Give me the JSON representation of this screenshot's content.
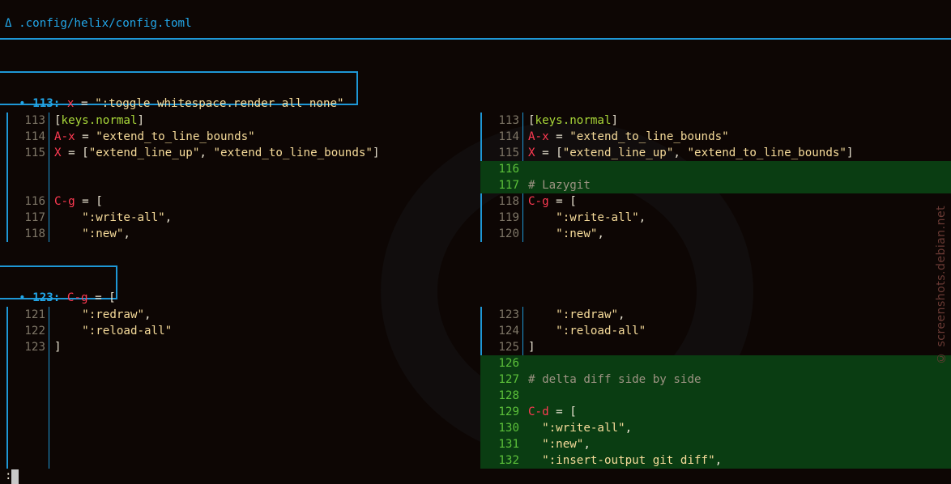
{
  "file_header": {
    "icon": "Δ",
    "path": ".config/helix/config.toml"
  },
  "hunks": [
    {
      "header": {
        "bullet": "•",
        "line_no": "113:",
        "code": [
          {
            "t": "x",
            "c": "k"
          },
          {
            "t": " = ",
            "c": "p"
          },
          {
            "t": "\":toggle whitespace.render all none\"",
            "c": "s"
          }
        ]
      },
      "left": [
        {
          "num": "113",
          "code": [
            {
              "t": "[",
              "c": "p"
            },
            {
              "t": "keys.normal",
              "c": "t"
            },
            {
              "t": "]",
              "c": "p"
            }
          ]
        },
        {
          "num": "114",
          "code": [
            {
              "t": "A-x",
              "c": "k"
            },
            {
              "t": " = ",
              "c": "p"
            },
            {
              "t": "\"extend_to_line_bounds\"",
              "c": "s"
            }
          ]
        },
        {
          "num": "115",
          "code": [
            {
              "t": "X",
              "c": "k"
            },
            {
              "t": " = [",
              "c": "p"
            },
            {
              "t": "\"extend_line_up\"",
              "c": "s"
            },
            {
              "t": ", ",
              "c": "p"
            },
            {
              "t": "\"extend_to_line_bounds\"",
              "c": "s"
            },
            {
              "t": "]",
              "c": "p"
            }
          ]
        },
        {
          "num": "",
          "code": []
        },
        {
          "num": "",
          "code": []
        },
        {
          "num": "116",
          "code": [
            {
              "t": "C-g",
              "c": "k"
            },
            {
              "t": " = [",
              "c": "p"
            }
          ]
        },
        {
          "num": "117",
          "code": [
            {
              "t": "    ",
              "c": "p"
            },
            {
              "t": "\":write-all\"",
              "c": "s"
            },
            {
              "t": ",",
              "c": "p"
            }
          ]
        },
        {
          "num": "118",
          "code": [
            {
              "t": "    ",
              "c": "p"
            },
            {
              "t": "\":new\"",
              "c": "s"
            },
            {
              "t": ",",
              "c": "p"
            }
          ]
        }
      ],
      "right": [
        {
          "num": "113",
          "code": [
            {
              "t": "[",
              "c": "p"
            },
            {
              "t": "keys.normal",
              "c": "t"
            },
            {
              "t": "]",
              "c": "p"
            }
          ]
        },
        {
          "num": "114",
          "code": [
            {
              "t": "A-x",
              "c": "k"
            },
            {
              "t": " = ",
              "c": "p"
            },
            {
              "t": "\"extend_to_line_bounds\"",
              "c": "s"
            }
          ]
        },
        {
          "num": "115",
          "code": [
            {
              "t": "X",
              "c": "k"
            },
            {
              "t": " = [",
              "c": "p"
            },
            {
              "t": "\"extend_line_up\"",
              "c": "s"
            },
            {
              "t": ", ",
              "c": "p"
            },
            {
              "t": "\"extend_to_line_bounds\"",
              "c": "s"
            },
            {
              "t": "]",
              "c": "p"
            }
          ]
        },
        {
          "num": "116",
          "added": true,
          "code": []
        },
        {
          "num": "117",
          "added": true,
          "code": [
            {
              "t": "# Lazygit",
              "c": "c"
            }
          ]
        },
        {
          "num": "118",
          "code": [
            {
              "t": "C-g",
              "c": "k"
            },
            {
              "t": " = [",
              "c": "p"
            }
          ]
        },
        {
          "num": "119",
          "code": [
            {
              "t": "    ",
              "c": "p"
            },
            {
              "t": "\":write-all\"",
              "c": "s"
            },
            {
              "t": ",",
              "c": "p"
            }
          ]
        },
        {
          "num": "120",
          "code": [
            {
              "t": "    ",
              "c": "p"
            },
            {
              "t": "\":new\"",
              "c": "s"
            },
            {
              "t": ",",
              "c": "p"
            }
          ]
        }
      ]
    },
    {
      "header": {
        "bullet": "•",
        "line_no": "123:",
        "code": [
          {
            "t": "C-g",
            "c": "k"
          },
          {
            "t": " = [",
            "c": "p"
          }
        ]
      },
      "left": [
        {
          "num": "121",
          "code": [
            {
              "t": "    ",
              "c": "p"
            },
            {
              "t": "\":redraw\"",
              "c": "s"
            },
            {
              "t": ",",
              "c": "p"
            }
          ]
        },
        {
          "num": "122",
          "code": [
            {
              "t": "    ",
              "c": "p"
            },
            {
              "t": "\":reload-all\"",
              "c": "s"
            }
          ]
        },
        {
          "num": "123",
          "code": [
            {
              "t": "]",
              "c": "p"
            }
          ]
        }
      ],
      "right": [
        {
          "num": "123",
          "code": [
            {
              "t": "    ",
              "c": "p"
            },
            {
              "t": "\":redraw\"",
              "c": "s"
            },
            {
              "t": ",",
              "c": "p"
            }
          ]
        },
        {
          "num": "124",
          "code": [
            {
              "t": "    ",
              "c": "p"
            },
            {
              "t": "\":reload-all\"",
              "c": "s"
            }
          ]
        },
        {
          "num": "125",
          "code": [
            {
              "t": "]",
              "c": "p"
            }
          ]
        },
        {
          "num": "126",
          "added": true,
          "code": []
        },
        {
          "num": "127",
          "added": true,
          "code": [
            {
              "t": "# delta diff side by side",
              "c": "c"
            }
          ]
        },
        {
          "num": "128",
          "added": true,
          "code": []
        },
        {
          "num": "129",
          "added": true,
          "code": [
            {
              "t": "C-d",
              "c": "k"
            },
            {
              "t": " = [",
              "c": "p"
            }
          ]
        },
        {
          "num": "130",
          "added": true,
          "code": [
            {
              "t": "  ",
              "c": "p"
            },
            {
              "t": "\":write-all\"",
              "c": "s"
            },
            {
              "t": ",",
              "c": "p"
            }
          ]
        },
        {
          "num": "131",
          "added": true,
          "code": [
            {
              "t": "  ",
              "c": "p"
            },
            {
              "t": "\":new\"",
              "c": "s"
            },
            {
              "t": ",",
              "c": "p"
            }
          ]
        },
        {
          "num": "132",
          "added": true,
          "code": [
            {
              "t": "  ",
              "c": "p"
            },
            {
              "t": "\":insert-output git diff\"",
              "c": "s"
            },
            {
              "t": ",",
              "c": "p"
            }
          ]
        }
      ]
    }
  ],
  "prompt": {
    "text": ":"
  },
  "watermark": {
    "text": "© screenshots.debian.net"
  }
}
